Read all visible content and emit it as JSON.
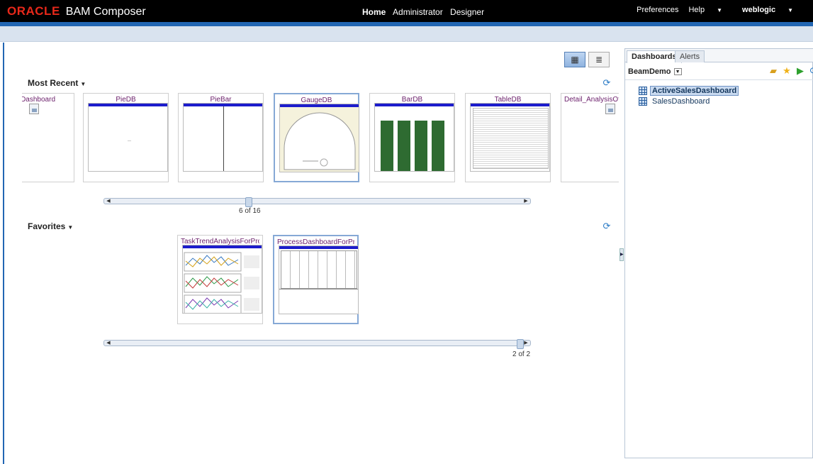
{
  "app": {
    "brand_oracle": "ORACLE",
    "brand_product": "BAM Composer",
    "nav": [
      "Home",
      "Administrator",
      "Designer"
    ],
    "preferences": "Preferences",
    "help": "Help",
    "user": "weblogic"
  },
  "most_recent": {
    "title": "Most Recent",
    "tiles": [
      "sDashboard",
      "PieDB",
      "PieBar",
      "GaugeDB",
      "BarDB",
      "TableDB",
      "Detail_AnalysisOfc"
    ],
    "pager": "6 of 16"
  },
  "favorites": {
    "title": "Favorites",
    "tiles": [
      "TaskTrendAnalysisForProcess",
      "ProcessDashboardForProcess"
    ],
    "pager": "2 of 2"
  },
  "right_panel": {
    "tabs": [
      "Dashboards",
      "Alerts"
    ],
    "selector": "BeamDemo",
    "items": [
      "ActiveSalesDashboard",
      "SalesDashboard"
    ]
  },
  "colors": {
    "header_bg": "#000000",
    "oracle_red": "#e8281a",
    "accent_blue": "#2266b3",
    "tile_title": "#6b1f6b",
    "bar_green": "#2e6b31"
  }
}
